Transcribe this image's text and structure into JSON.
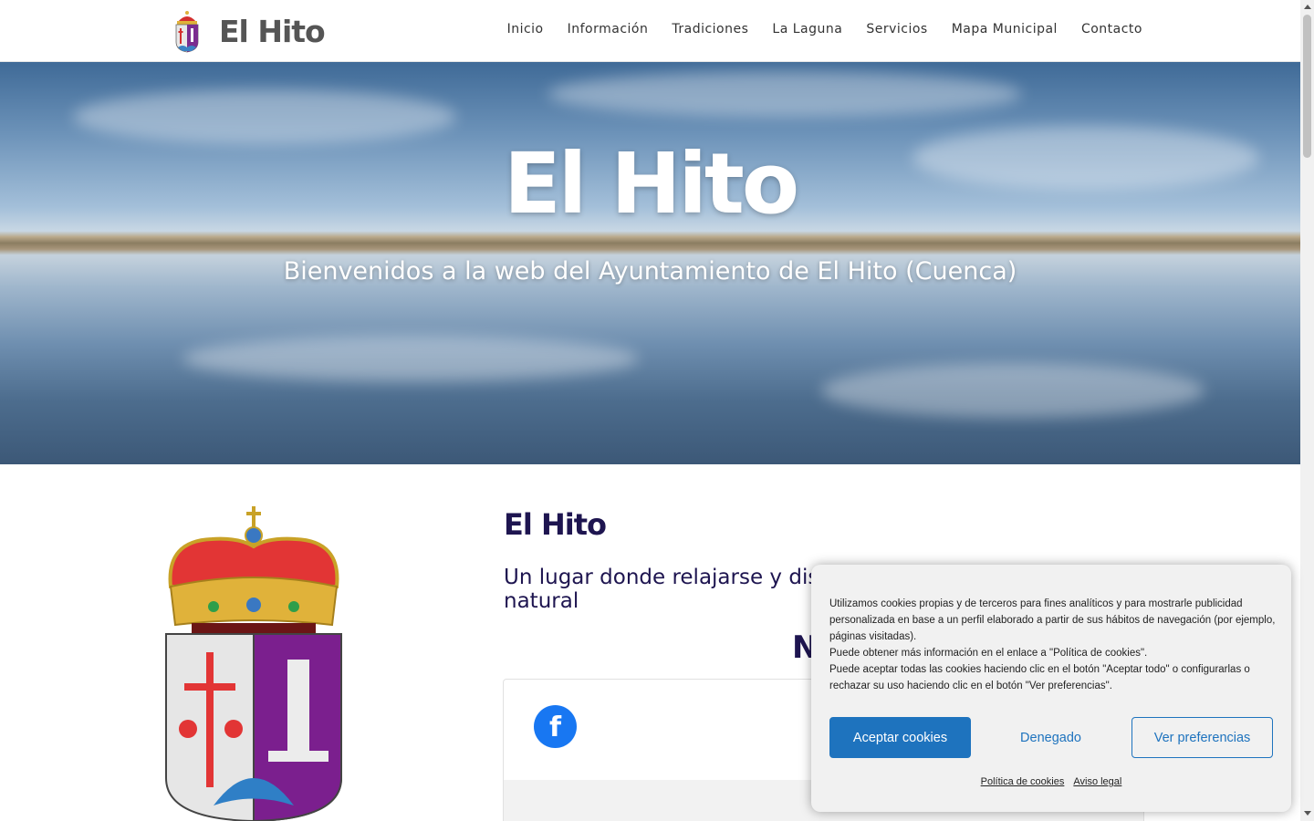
{
  "header": {
    "logo_text": "El Hito",
    "nav": [
      {
        "label": "Inicio"
      },
      {
        "label": "Información"
      },
      {
        "label": "Tradiciones"
      },
      {
        "label": "La Laguna"
      },
      {
        "label": "Servicios"
      },
      {
        "label": "Mapa Municipal"
      },
      {
        "label": "Contacto"
      }
    ]
  },
  "hero": {
    "title": "El Hito",
    "subtitle": "Bienvenidos a la web del Ayuntamiento de El Hito (Cuenca)"
  },
  "main": {
    "title": "El Hito",
    "subtitle": "Un lugar donde relajarse y dis",
    "subtitle_line2": "natural",
    "section_title": "Not",
    "facebook_icon_glyph": "f"
  },
  "cookie_banner": {
    "lines": [
      "Utilizamos cookies propias y de terceros para fines analíticos y para mostrarle publicidad personalizada en base a un perfil elaborado a partir de sus hábitos de navegación (por ejemplo, páginas visitadas).",
      "Puede obtener más información en el enlace a \"Política de cookies\".",
      "Puede aceptar todas las cookies haciendo clic en el botón \"Aceptar todo\" o configurarlas o rechazar su uso haciendo clic en el botón \"Ver preferencias\"."
    ],
    "accept_label": "Aceptar cookies",
    "deny_label": "Denegado",
    "prefs_label": "Ver preferencias",
    "policy_link": "Política de cookies",
    "legal_link": "Aviso legal"
  },
  "colors": {
    "heading": "#1e1550",
    "accent": "#1e73be",
    "facebook": "#1877f2"
  }
}
